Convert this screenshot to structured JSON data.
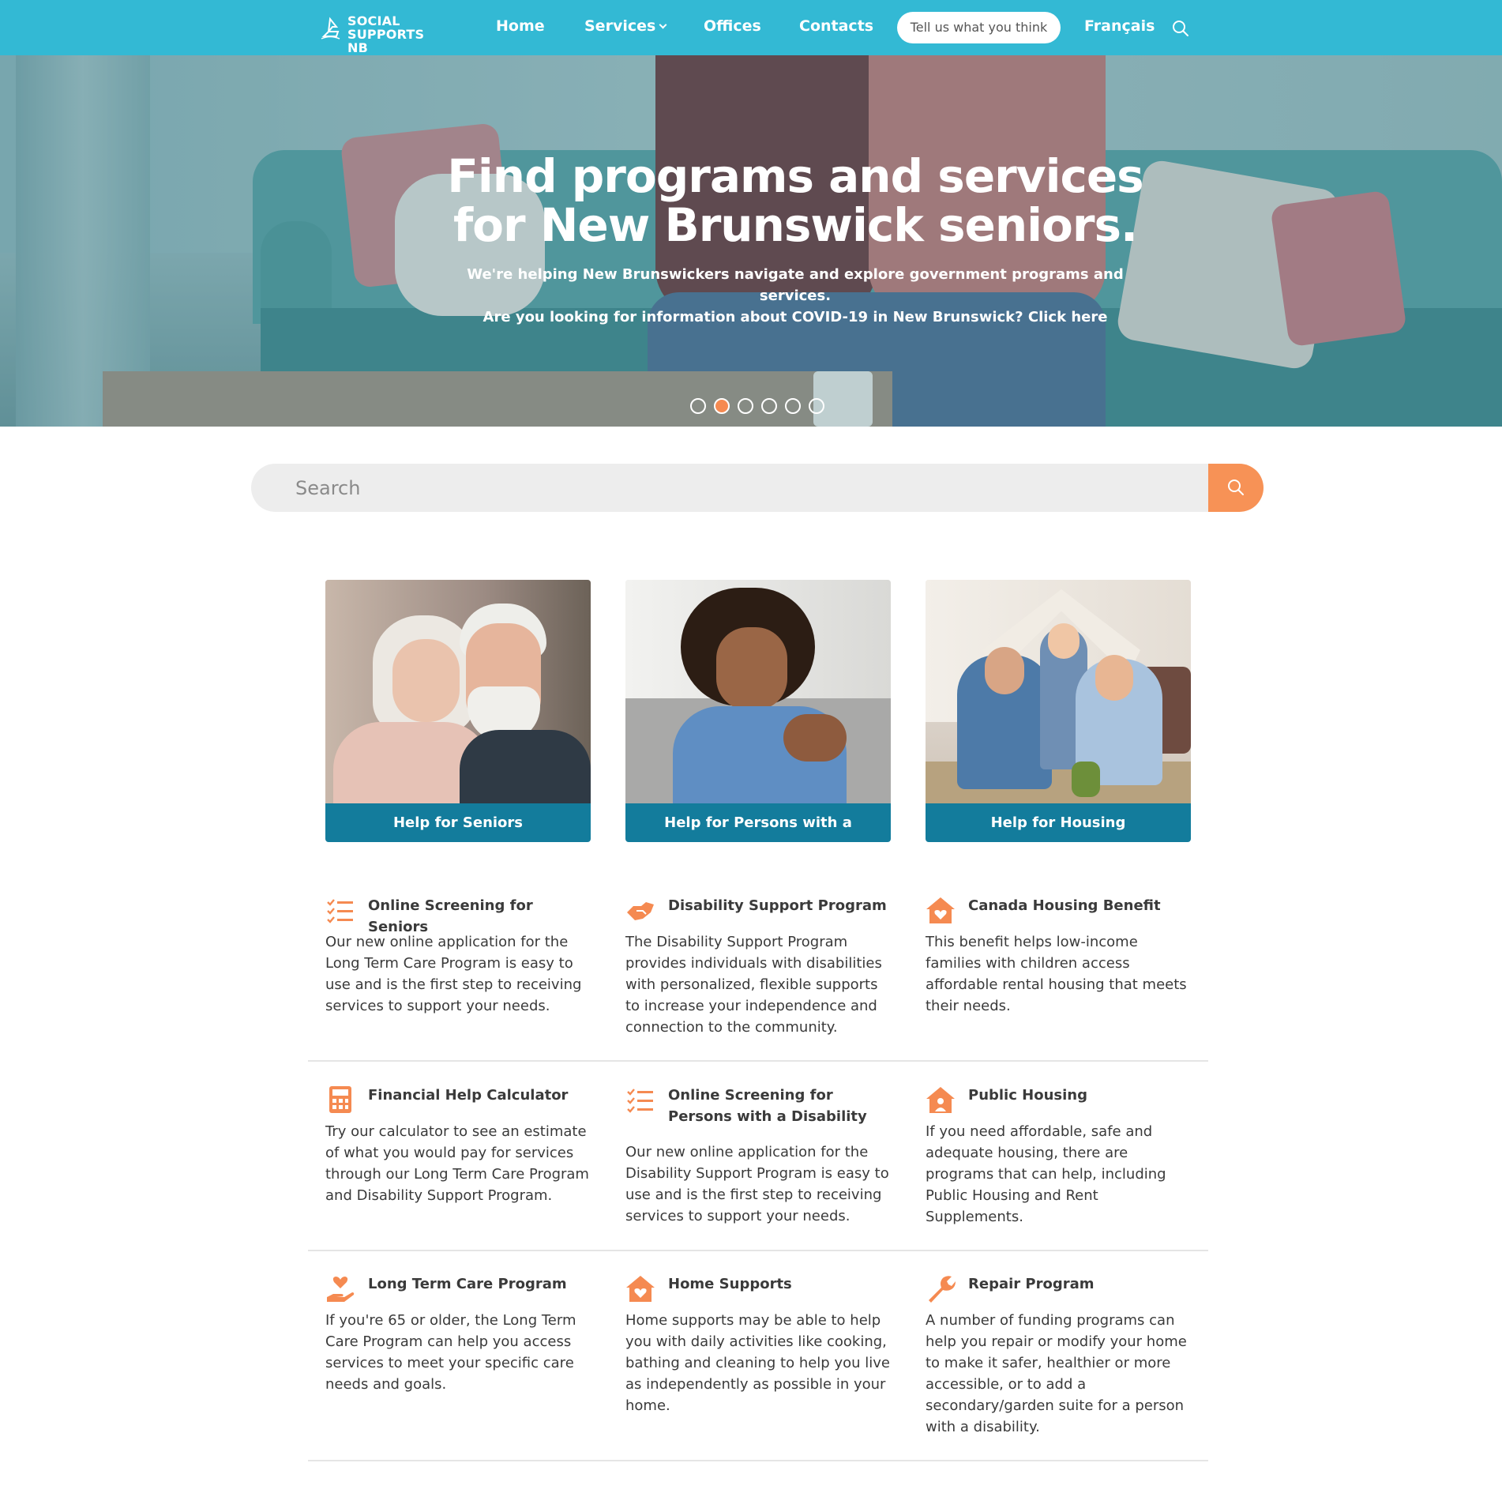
{
  "nav": {
    "logo_line1": "SOCIAL",
    "logo_line2": "SUPPORTS NB",
    "home": "Home",
    "services": "Services",
    "offices": "Offices",
    "contacts": "Contacts",
    "feedback": "Tell us what you think",
    "language": "Français",
    "search_icon": "search-icon"
  },
  "hero": {
    "title_line1": "Find programs and services",
    "title_line2": "for New Brunswick seniors.",
    "sub_line1": "We're helping New Brunswickers navigate and explore government programs and",
    "sub_line2": "services.",
    "sub_line3": "Are you looking for information about COVID-19 in New Brunswick?",
    "sub_link": "Click here",
    "slides_total": 6,
    "active_slide": 2
  },
  "search": {
    "placeholder": "Search"
  },
  "cards": [
    {
      "label": "Help for Seniors"
    },
    {
      "label": "Help for Persons with a Disability"
    },
    {
      "label": "Help for Housing"
    }
  ],
  "programs": [
    {
      "title": "Online Screening for Seniors",
      "icon": "checklist-icon",
      "desc": "Our new online application for the Long Term Care Program is easy to use and is the first step to receiving services to support your needs."
    },
    {
      "title": "Disability Support Program",
      "icon": "handshake-icon",
      "desc": "The Disability Support Program provides individuals with disabilities with personalized, flexible supports to increase your independence and connection to the community."
    },
    {
      "title": "Canada Housing Benefit",
      "icon": "house-heart-icon",
      "desc": "This benefit helps low-income families with children access affordable rental housing that meets their needs."
    },
    {
      "title": "Financial Help Calculator",
      "icon": "calculator-icon",
      "desc": "Try our calculator to see an estimate of what you would pay for services through our Long Term Care Program and Disability Support Program."
    },
    {
      "title": "Online Screening for Persons with a Disability",
      "icon": "checklist-icon",
      "desc": "Our new online application for the Disability Support Program is easy to use and is the first step to receiving services to support your needs."
    },
    {
      "title": "Public Housing",
      "icon": "house-person-icon",
      "desc": "If you need affordable, safe and adequate housing, there are programs that can help, including Public Housing and Rent Supplements."
    },
    {
      "title": "Long Term Care Program",
      "icon": "hand-heart-icon",
      "desc": "If you're 65 or older, the Long Term Care Program can help you access services to meet your specific care needs and goals."
    },
    {
      "title": "Home Supports",
      "icon": "house-heart-icon",
      "desc": "Home supports may be able to help you with daily activities like cooking, bathing and cleaning to help you live as independently as possible in your home."
    },
    {
      "title": "Repair Program",
      "icon": "wrench-icon",
      "desc": "A number of funding programs can help you repair or modify your home to make it safer, healthier or more accessible, or to add a secondary/garden suite for a person with a disability."
    }
  ],
  "colors": {
    "nav_bg": "#33b9d4",
    "accent_orange": "#f58a51",
    "card_label_bg": "#137c9c"
  }
}
